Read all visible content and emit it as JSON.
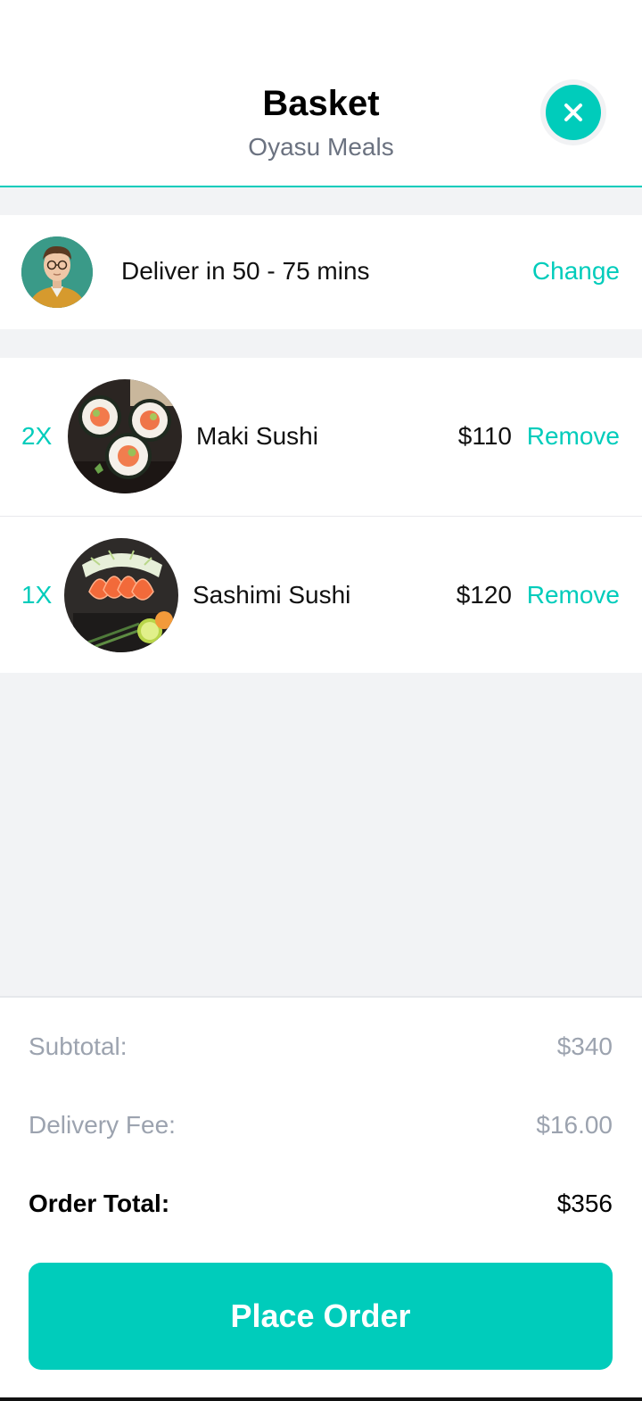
{
  "header": {
    "title": "Basket",
    "subtitle": "Oyasu Meals",
    "close_icon": "close-icon"
  },
  "delivery": {
    "avatar_icon": "user-avatar",
    "text": "Deliver in 50 - 75 mins",
    "change_label": "Change"
  },
  "items": [
    {
      "qty": "2X",
      "name": "Maki Sushi",
      "price": "$110",
      "remove_label": "Remove",
      "image": "maki-sushi-image"
    },
    {
      "qty": "1X",
      "name": "Sashimi Sushi",
      "price": "$120",
      "remove_label": "Remove",
      "image": "sashimi-sushi-image"
    }
  ],
  "summary": {
    "subtotal_label": "Subtotal:",
    "subtotal_value": "$340",
    "delivery_label": "Delivery Fee:",
    "delivery_value": "$16.00",
    "total_label": "Order Total:",
    "total_value": "$356"
  },
  "place_order_label": "Place Order",
  "colors": {
    "accent": "#00ccbb",
    "background": "#f2f3f5",
    "muted_text": "#9ca3af"
  }
}
